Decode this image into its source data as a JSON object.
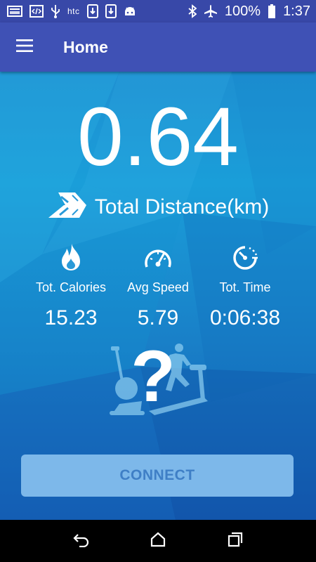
{
  "status_bar": {
    "battery_percent": "100%",
    "time": "1:37",
    "carrier": "htc",
    "left_icons": [
      "image-icon",
      "code-icon",
      "usb-icon",
      "htc-icon",
      "download-icon",
      "download-icon",
      "android-icon"
    ],
    "right_icons": [
      "bluetooth-icon",
      "airplane-icon",
      "battery-icon"
    ]
  },
  "app_bar": {
    "title": "Home",
    "menu_icon": "menu-icon"
  },
  "distance": {
    "value": "0.64",
    "label": "Total Distance(km)",
    "icon": "road-icon"
  },
  "stats": [
    {
      "label": "Tot. Calories",
      "value": "15.23",
      "icon": "flame-icon"
    },
    {
      "label": "Avg Speed",
      "value": "5.79",
      "icon": "speedometer-icon"
    },
    {
      "label": "Tot. Time",
      "value": "0:06:38",
      "icon": "timer-icon"
    }
  ],
  "device_placeholder": {
    "symbol": "?",
    "icon": "exercise-equipment-icon"
  },
  "connect_button": {
    "label": "CONNECT"
  },
  "nav_bar": {
    "icons": [
      "back-icon",
      "home-icon",
      "recents-icon"
    ]
  },
  "colors": {
    "status_bar": "#3848a8",
    "app_bar": "#3f51b5",
    "background_top": "#1a9ed9",
    "background_bottom": "#1458b0",
    "connect_button": "#7db8ea",
    "connect_text": "#3f7fc6"
  }
}
